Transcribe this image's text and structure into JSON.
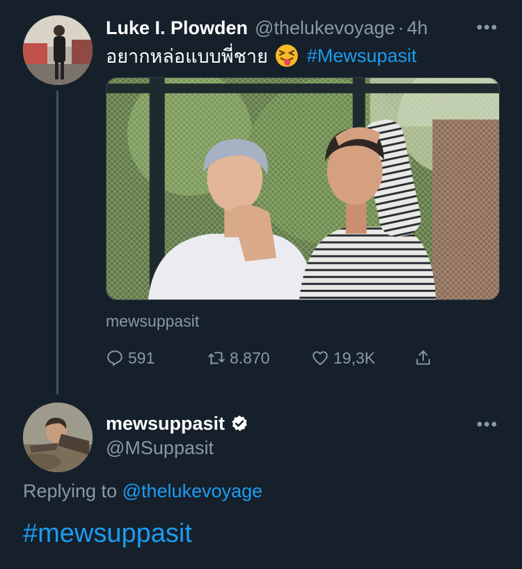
{
  "tweet1": {
    "author_name": "Luke I. Plowden",
    "handle": "@thelukevoyage",
    "separator": "·",
    "time": "4h",
    "more": "•••",
    "text": "อยากหล่อแบบพี่ชาย",
    "emoji": "squinting-face-with-tongue",
    "hashtag": "#Mewsupasit",
    "media_credit": "mewsuppasit",
    "reply_count": "591",
    "retweet_count": "8.870",
    "like_count": "19,3K"
  },
  "tweet2": {
    "author_name": "mewsuppasit",
    "verified": true,
    "handle": "@MSuppasit",
    "more": "•••",
    "replying_prefix": "Replying to",
    "replying_to": "@thelukevoyage",
    "text": "#mewsuppasit"
  },
  "colors": {
    "background": "#15202b",
    "accent": "#1d9bf0",
    "secondary_text": "#8b98a5",
    "thread_line": "#3d5466"
  },
  "icons": [
    "reply-icon",
    "retweet-icon",
    "like-icon",
    "share-icon",
    "verified-badge-icon",
    "more-icon"
  ]
}
